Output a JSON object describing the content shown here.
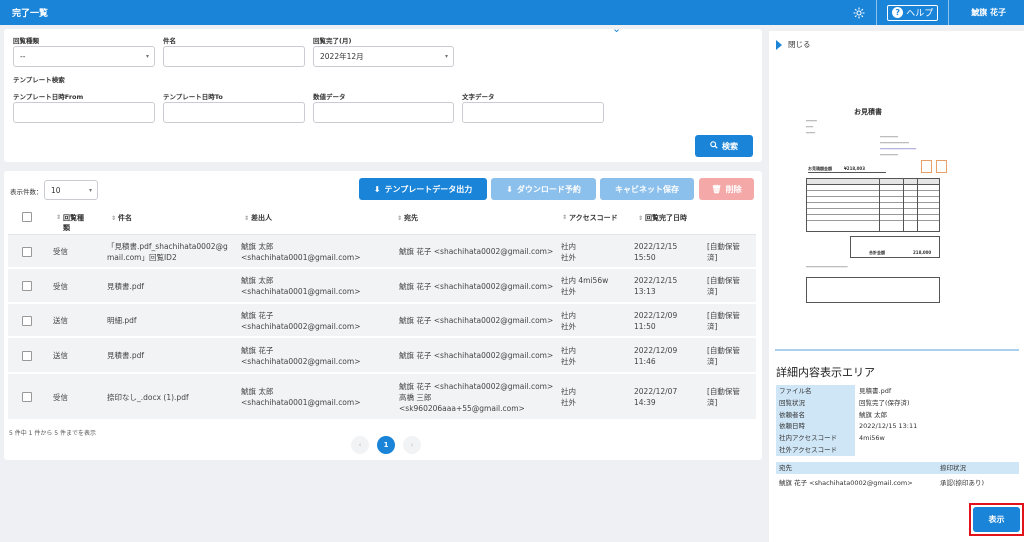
{
  "topbar": {
    "title": "完了一覧",
    "help": "ヘルプ",
    "user": "鯱旗 花子"
  },
  "search": {
    "labels": {
      "type": "回覧種類",
      "subject": "件名",
      "completed": "回覧完了(月)",
      "template_search": "テンプレート検索",
      "tpl_from": "テンプレート日時From",
      "tpl_to": "テンプレート日時To",
      "number": "数値データ",
      "text": "文字データ"
    },
    "values": {
      "type": "--",
      "subject": "",
      "completed": "2022年12月",
      "tpl_from": "",
      "tpl_to": "",
      "number": "",
      "text": ""
    },
    "search_button": "検索"
  },
  "list": {
    "count_label": "表示件数：",
    "count_value": "10",
    "buttons": {
      "export": "テンプレートデータ出力",
      "download": "ダウンロード予約",
      "cabinet": "キャビネット保存",
      "delete": "削除"
    },
    "headers": {
      "type": "回覧種類",
      "subject": "件名",
      "sender": "差出人",
      "dest": "宛先",
      "access": "アクセスコード",
      "completed": "回覧完了日時"
    },
    "rows": [
      {
        "type": "受信",
        "subject1": "「見積書.pdf_shachihata0002@g",
        "subject2": "mail.com」回覧ID2",
        "sender1": "鯱旗 太郎",
        "sender2": "<shachihata0001@gmail.com>",
        "dest1": "鯱旗 花子 <shachihata0002@gmail.com>",
        "dest2": "",
        "dest3": "",
        "access1": "社内",
        "access2": "社外",
        "date1": "2022/12/15",
        "date2": "15:50",
        "status1": "[自動保管",
        "status2": "済]"
      },
      {
        "type": "受信",
        "subject1": "見積書.pdf",
        "subject2": "",
        "sender1": "鯱旗 太郎",
        "sender2": "<shachihata0001@gmail.com>",
        "dest1": "鯱旗 花子 <shachihata0002@gmail.com>",
        "dest2": "",
        "dest3": "",
        "access1": "社内 4mi56w",
        "access2": "社外",
        "date1": "2022/12/15",
        "date2": "13:13",
        "status1": "[自動保管",
        "status2": "済]"
      },
      {
        "type": "送信",
        "subject1": "明細.pdf",
        "subject2": "",
        "sender1": "鯱旗 花子",
        "sender2": "<shachihata0002@gmail.com>",
        "dest1": "鯱旗 花子 <shachihata0002@gmail.com>",
        "dest2": "",
        "dest3": "",
        "access1": "社内",
        "access2": "社外",
        "date1": "2022/12/09",
        "date2": "11:50",
        "status1": "[自動保管",
        "status2": "済]"
      },
      {
        "type": "送信",
        "subject1": "見積書.pdf",
        "subject2": "",
        "sender1": "鯱旗 花子",
        "sender2": "<shachihata0002@gmail.com>",
        "dest1": "鯱旗 花子 <shachihata0002@gmail.com>",
        "dest2": "",
        "dest3": "",
        "access1": "社内",
        "access2": "社外",
        "date1": "2022/12/09",
        "date2": "11:46",
        "status1": "[自動保管",
        "status2": "済]"
      },
      {
        "type": "受信",
        "subject1": "捺印なし_.docx (1).pdf",
        "subject2": "",
        "sender1": "鯱旗 太郎",
        "sender2": "<shachihata0001@gmail.com>",
        "dest1": "鯱旗 花子 <shachihata0002@gmail.com>",
        "dest2": "高橋 三郎",
        "dest3": "<sk960206aaa+55@gmail.com>",
        "access1": "社内",
        "access2": "社外",
        "date1": "2022/12/07",
        "date2": "14:39",
        "status1": "[自動保管",
        "status2": "済]"
      }
    ],
    "footer": "5 件中 1 件から 5 件までを表示",
    "page": "1"
  },
  "side": {
    "close": "閉じる",
    "doc_title": "お見積書",
    "doc_total_label": "お見積額金額",
    "doc_total": "¥218,003",
    "doc_grand_label": "合計金額",
    "doc_grand": "218,000",
    "detail_title": "詳細内容表示エリア",
    "details": [
      {
        "label": "ファイル名",
        "value": "見積書.pdf"
      },
      {
        "label": "回覧状況",
        "value": "回覧完了(保存済)"
      },
      {
        "label": "依頼者名",
        "value": "鯱旗 太郎"
      },
      {
        "label": "依頼日時",
        "value": "2022/12/15 13:11"
      },
      {
        "label": "社内アクセスコード",
        "value": "4mi56w"
      },
      {
        "label": "社外アクセスコード",
        "value": ""
      }
    ],
    "dest_header": "宛先",
    "stamp_header": "捺印状況",
    "dest_value": "鯱旗 花子 <shachihata0002@gmail.com>",
    "stamp_value": "承認(捺印あり)",
    "show_button": "表示"
  }
}
